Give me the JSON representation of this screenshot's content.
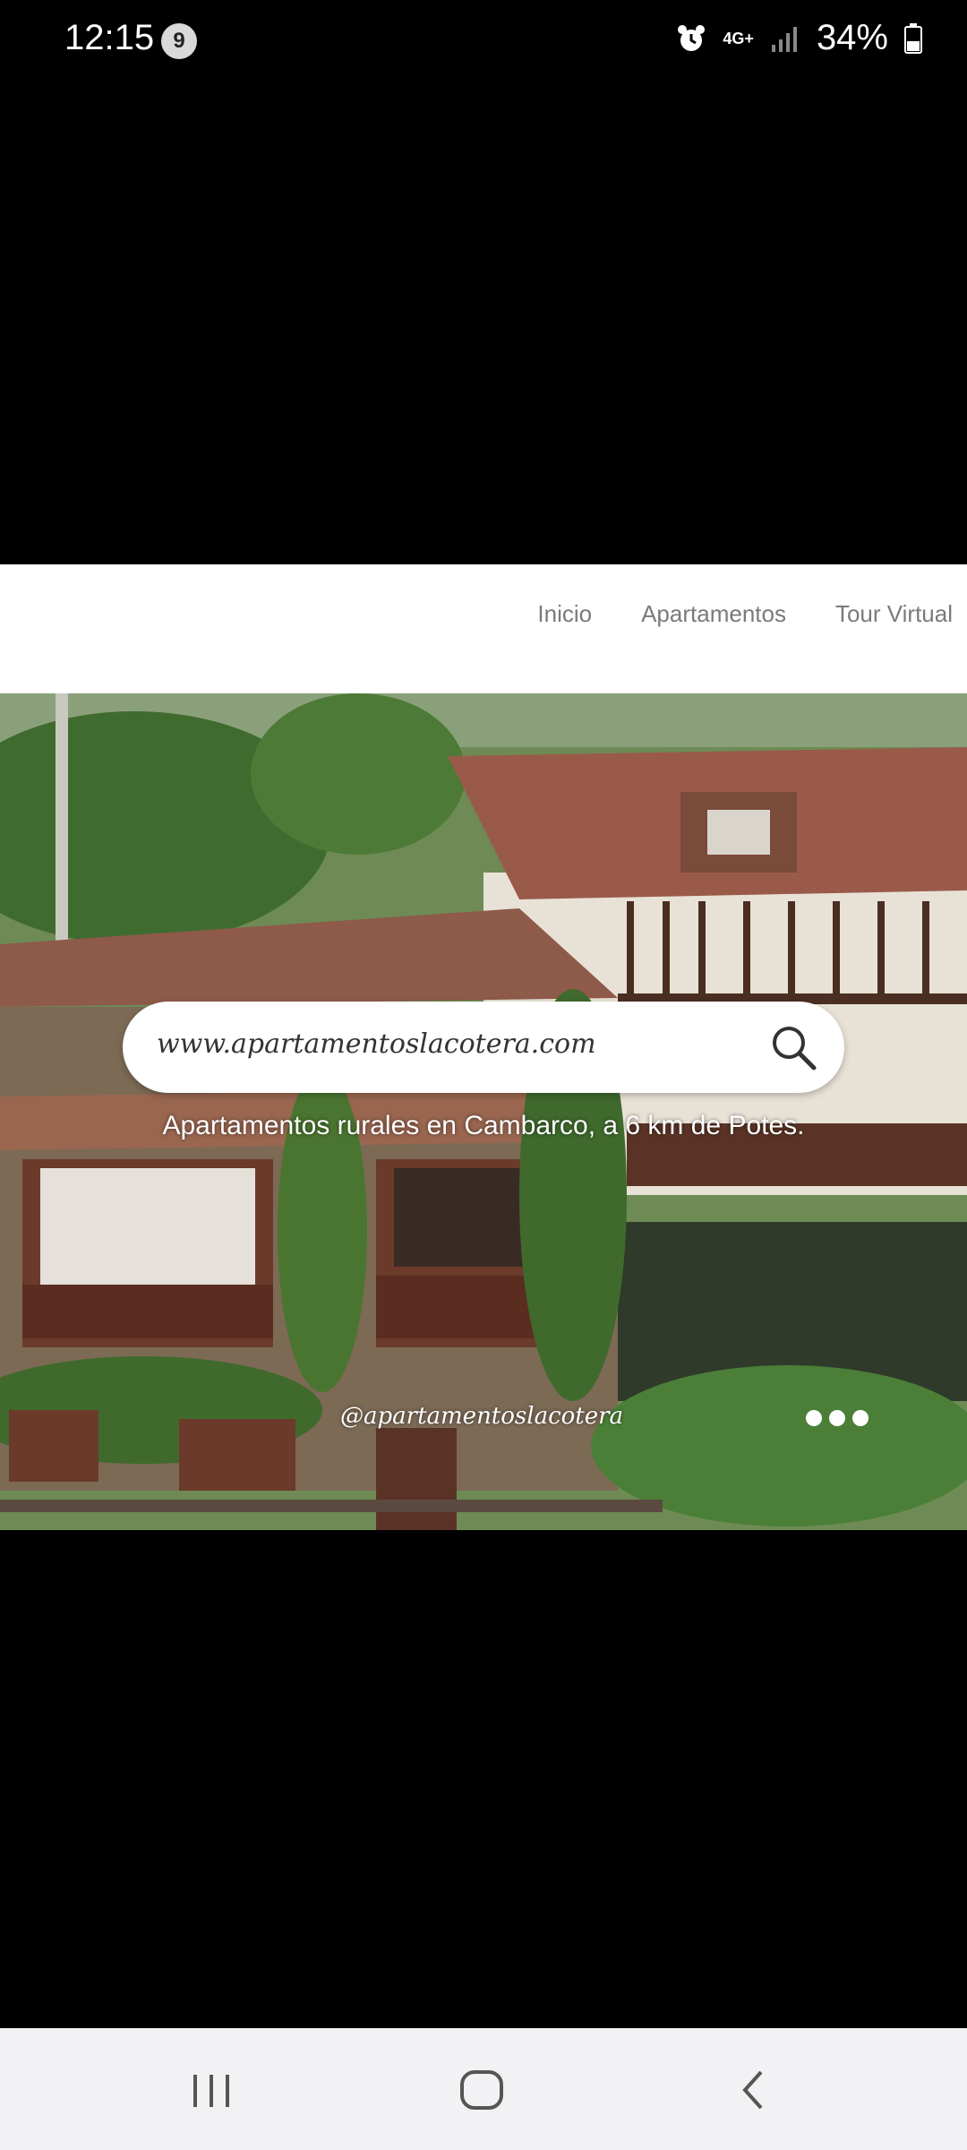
{
  "status_bar": {
    "time": "12:15",
    "notification_count": "9",
    "network_type": "4G+",
    "battery_percent": "34%"
  },
  "page": {
    "nav_items": [
      "Inicio",
      "Apartamentos",
      "Tour Virtual"
    ],
    "hero": {
      "search_url": "www.apartamentoslacotera.com",
      "tagline": "Apartamentos rurales en Cambarco, a 6 km de Potes.",
      "social_handle": "@apartamentoslacotera"
    }
  },
  "icons": [
    "alarm-icon",
    "signal-icon",
    "battery-icon",
    "search-icon",
    "more-icon",
    "recents-icon",
    "home-icon",
    "back-icon"
  ]
}
